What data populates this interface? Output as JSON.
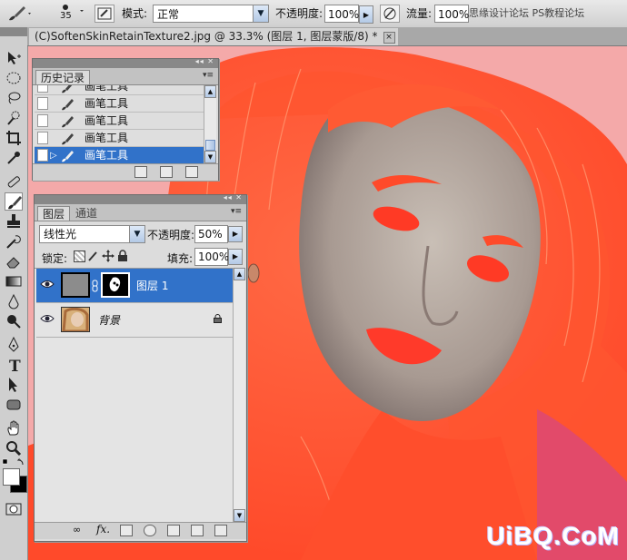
{
  "options_bar": {
    "brush_size": "35",
    "mode_label": "模式:",
    "mode_value": "正常",
    "opacity_label": "不透明度:",
    "opacity_value": "100%",
    "flow_label": "流量:",
    "flow_value": "100%",
    "watermark_top": "思缘设计论坛 PS教程论坛"
  },
  "document_tab": {
    "title": "(C)SoftenSkinRetainTexture2.jpg @ 33.3% (图层 1, 图层蒙版/8) *",
    "close_label": "×"
  },
  "history_panel": {
    "tab_label": "历史记录",
    "items": [
      {
        "label": "画笔工具"
      },
      {
        "label": "画笔工具"
      },
      {
        "label": "画笔工具"
      },
      {
        "label": "画笔工具"
      },
      {
        "label": "画笔工具"
      }
    ]
  },
  "layers_panel": {
    "tabs": [
      {
        "label": "图层"
      },
      {
        "label": "通道"
      }
    ],
    "blend_mode": "线性光",
    "opacity_label": "不透明度:",
    "opacity_value": "50%",
    "lock_label": "锁定:",
    "fill_label": "填充:",
    "fill_value": "100%",
    "layers": [
      {
        "name": "图层 1"
      },
      {
        "name": "背景"
      }
    ]
  },
  "canvas": {
    "brand_watermark": "UiBQ.CoM"
  },
  "colors": {
    "accent": "#3172c9",
    "canvas_bg": "#f4a9a9",
    "hair_red": "#ff5530"
  }
}
